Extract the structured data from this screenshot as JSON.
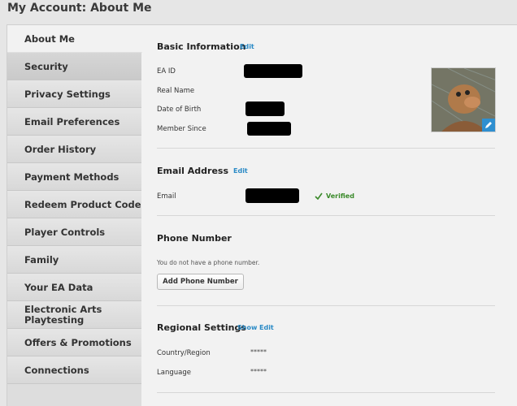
{
  "page": {
    "title": "My Account: About Me"
  },
  "sidebar": {
    "items": [
      {
        "label": "About Me"
      },
      {
        "label": "Security"
      },
      {
        "label": "Privacy Settings"
      },
      {
        "label": "Email Preferences"
      },
      {
        "label": "Order History"
      },
      {
        "label": "Payment Methods"
      },
      {
        "label": "Redeem Product Code"
      },
      {
        "label": "Player Controls"
      },
      {
        "label": "Family"
      },
      {
        "label": "Your EA Data"
      },
      {
        "label": "Electronic Arts Playtesting"
      },
      {
        "label": "Offers & Promotions"
      },
      {
        "label": "Connections"
      }
    ]
  },
  "basic_info": {
    "title": "Basic Information",
    "edit_label": "Edit",
    "fields": {
      "ea_id": "EA ID",
      "real_name": "Real Name",
      "dob": "Date of Birth",
      "member_since": "Member Since"
    }
  },
  "email": {
    "title": "Email Address",
    "edit_label": "Edit",
    "field_label": "Email",
    "status": "Verified"
  },
  "phone": {
    "title": "Phone Number",
    "message": "You do not have a phone number.",
    "button_label": "Add Phone Number"
  },
  "regional": {
    "title": "Regional Settings",
    "show_label": "Show",
    "edit_label": "Edit",
    "country_label": "Country/Region",
    "country_value": "*****",
    "language_label": "Language",
    "language_value": "*****"
  },
  "icons": {
    "verified": "checkmark-icon",
    "avatar_edit": "pencil-icon"
  },
  "colors": {
    "link": "#2a8ac6",
    "verified": "#3a8a2a",
    "badge": "#2f8fd0"
  }
}
